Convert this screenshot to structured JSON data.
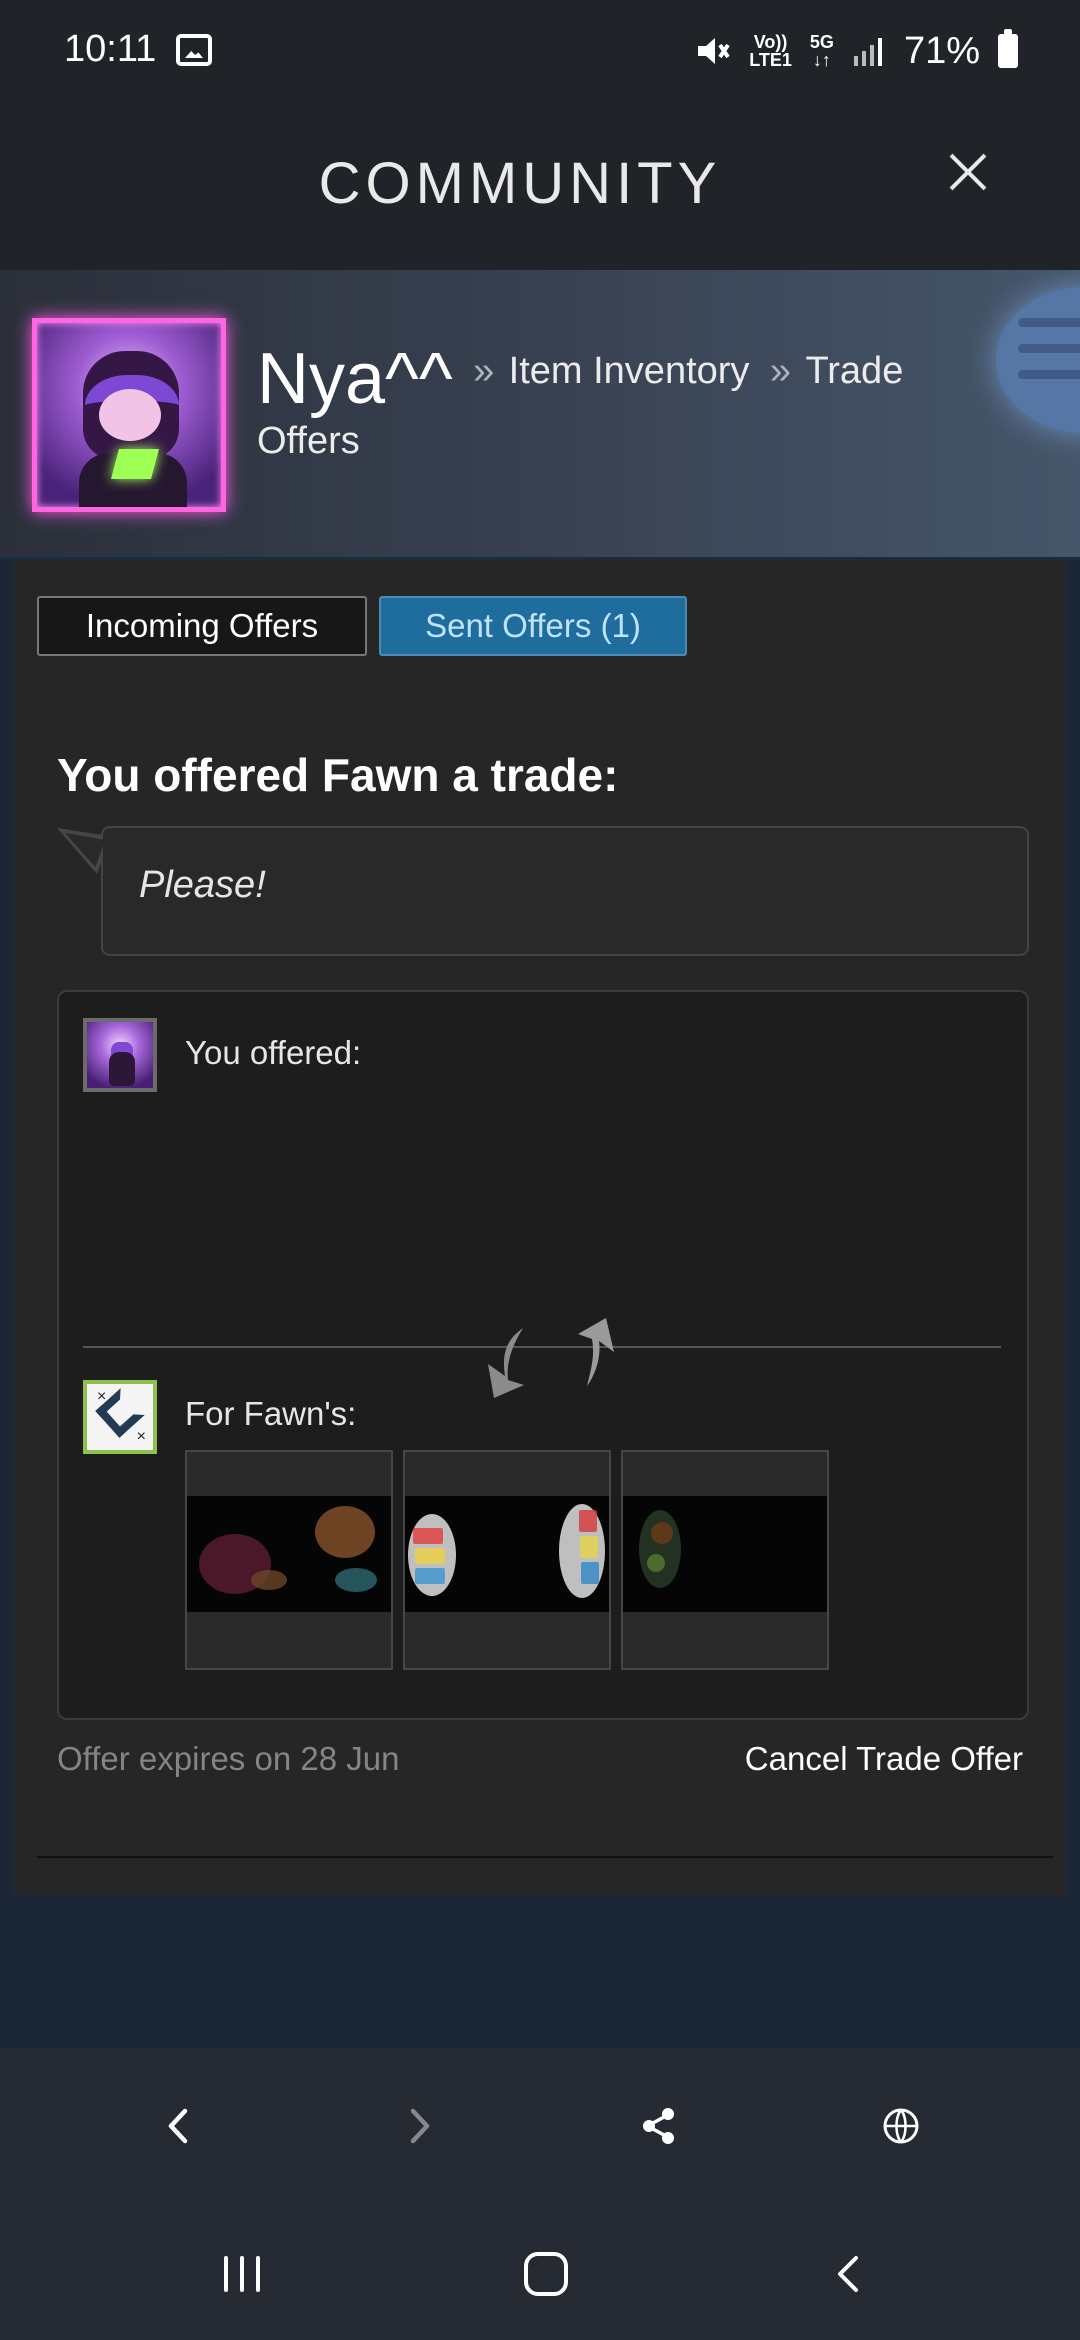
{
  "status_bar": {
    "time": "10:11",
    "network_top": "Vo))",
    "network_bottom": "LTE1",
    "five_g": "5G",
    "battery": "71%"
  },
  "app_header": {
    "title": "COMMUNITY",
    "close_icon": "close-icon"
  },
  "profile": {
    "name": "Nya^^",
    "separator": "»",
    "crumb_inventory": "Item Inventory",
    "crumb_trade": "Trade",
    "crumb_offers": "Offers",
    "menu_icon": "hamburger-menu-icon"
  },
  "tabs": {
    "incoming": "Incoming Offers",
    "sent": "Sent Offers (1)"
  },
  "offer": {
    "heading": "You offered Fawn a trade:",
    "message": "Please!",
    "you_label": "You offered:",
    "fawn_label": "For Fawn's:",
    "expires": "Offer expires on 28 Jun",
    "cancel": "Cancel Trade Offer"
  },
  "icons": {
    "swap": "swap-arrows-icon",
    "back": "back-icon",
    "forward": "forward-icon",
    "share": "share-icon",
    "globe": "globe-icon",
    "recent_apps": "recent-apps-icon",
    "home": "home-icon",
    "system_back": "system-back-icon"
  },
  "colors": {
    "sent_tab": "#1f6d9d",
    "avatar_glow": "#ff64e5",
    "fawn_avatar_border": "#8fc04d"
  }
}
